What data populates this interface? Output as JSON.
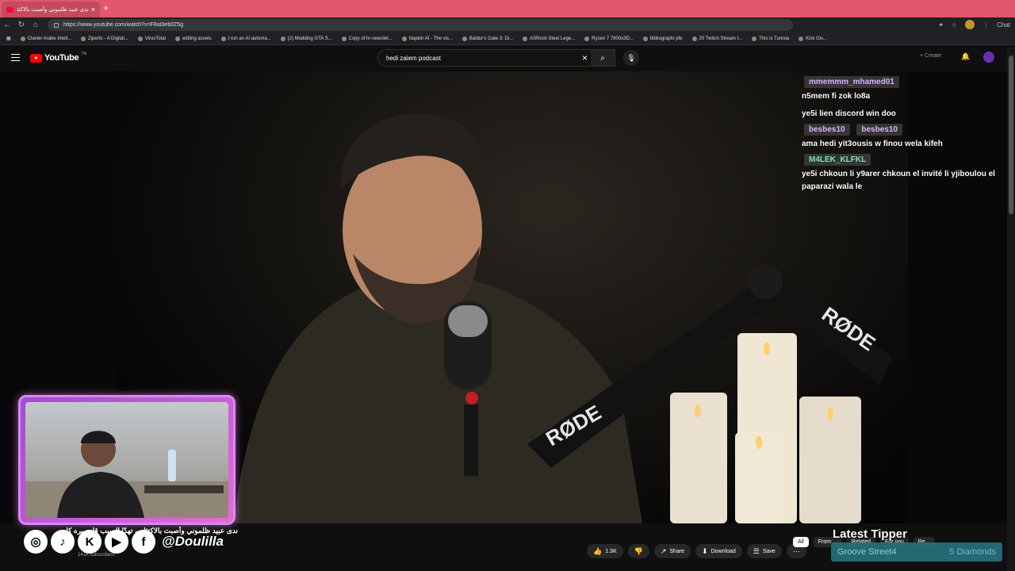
{
  "browser": {
    "tab_title": "ندى عبيد ظلموني وأصبت بالاكتئاب",
    "url": "https://www.youtube.com/watch?v=F8at3eb0Z5g",
    "bookmarks": [
      "Clavier Arabe Intell...",
      "Ziperto - A Digital...",
      "VirusTotal",
      "editing assets",
      "I run an AI automa...",
      "(2) Modding GTA S...",
      "Copy of hr-newslet...",
      "Napkin AI - The vis...",
      "Baldur's Gate 3: Di...",
      "ASRock Steel Lege...",
      "Ryzen 7 7800x3D...",
      "bibliographi pfe",
      "20 Twitch Stream I...",
      "This is Tunisia",
      "Kick Giv..."
    ],
    "chat_label": "Chat"
  },
  "youtube": {
    "logo_text": "YouTube",
    "logo_country": "TN",
    "search_value": "hedi zaiem podcast",
    "create_label": "Create"
  },
  "stream_chat": [
    {
      "user": "mmemmm_mhamed01",
      "message": "n5mem fi zok lo8a"
    },
    {
      "user": "",
      "message": "ye5i lien discord win doo"
    },
    {
      "user": "besbes10",
      "message": ""
    },
    {
      "user": "besbes10",
      "message": "ama hedi yit3ousis w finou wela kifeh"
    },
    {
      "user": "M4LEK_KLFKL",
      "message": "ye5i chkoun li y9arer chkoun el invité li yjiboulou el paparazi wala le"
    }
  ],
  "overlay": {
    "handle": "@Doulilla",
    "video_title_ar": "ندى عبيد ظلموني وأصبت بالاكتئاب، تهدّا السبب قلت بره كا...",
    "subscribers": "141K subscribers",
    "latest_tipper_label": "Latest Tipper",
    "tipper_name": "Groove Street4",
    "tipper_amount": "5 Diamonds"
  },
  "actions": {
    "like_count": "1.3K",
    "share_label": "Share",
    "download_label": "Download",
    "save_label": "Save"
  },
  "chips": [
    "All",
    "From ...",
    "Related",
    "For you",
    "Re..."
  ],
  "colors": {
    "tab_bar": "#e2576b",
    "youtube_red": "#ff0000",
    "cam_border": "#d28cf0",
    "chat_username": "#d7b3ff"
  }
}
